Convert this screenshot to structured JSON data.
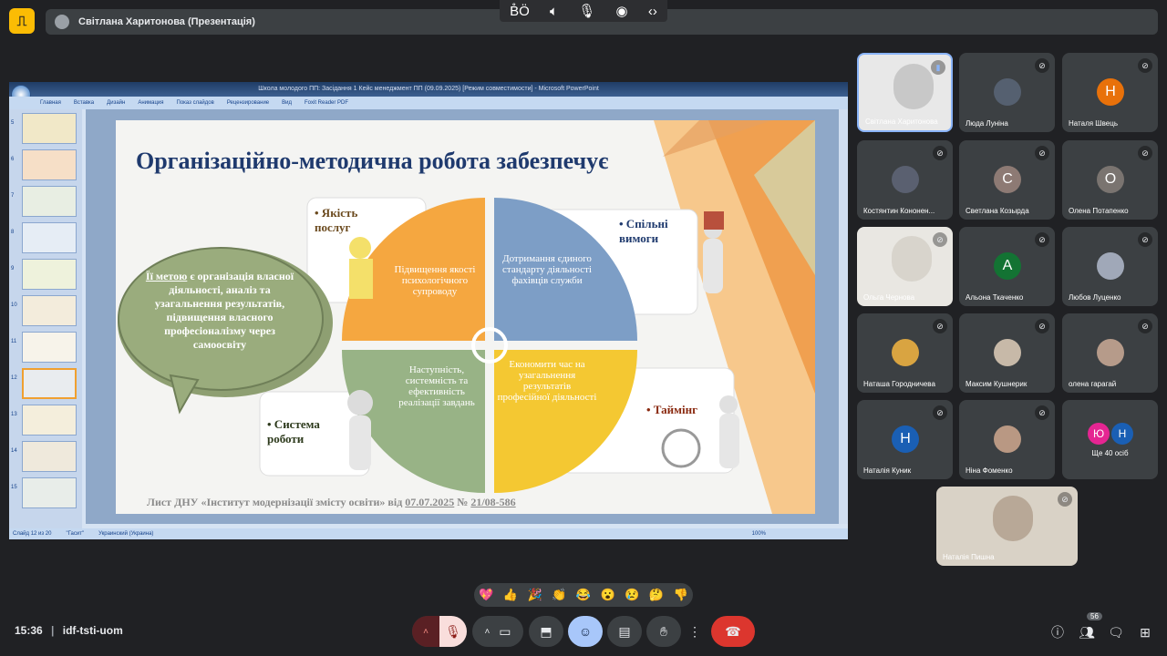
{
  "presenter_bar": {
    "title": "Світлана Харитонова (Презентація)"
  },
  "ppt": {
    "window_title": "Школа молодого ПП: Засідання 1 Кейс менеджмент ПП (09.09.2025) [Режим совместимости] - Microsoft PowerPoint",
    "ribbon_tabs": [
      "Главная",
      "Вставка",
      "Дизайн",
      "Анимация",
      "Показ слайдов",
      "Рецензирование",
      "Вид",
      "Foxit Reader PDF"
    ],
    "thumb_numbers": [
      "5",
      "6",
      "7",
      "8",
      "9",
      "10",
      "11",
      "12",
      "13",
      "14",
      "15"
    ],
    "status": {
      "slide": "Слайд 12 из 20",
      "theme": "\"Гасит\"",
      "lang": "Украинский (Украина)",
      "zoom": "100%"
    }
  },
  "slide": {
    "title": "Організаційно-методична робота забезпечує",
    "bubble": {
      "lead": "Її метою",
      "rest": " є організація власної діяльності, аналіз та узагальнення результатів, підвищення власного професіоналізму через самоосвіту"
    },
    "corner_labels": {
      "top_left": "• Якість послуг",
      "top_right": "• Спільні вимоги",
      "bottom_left": "• Система роботи",
      "bottom_right": "• Таймінг"
    },
    "quadrants": {
      "q1": "Підвищення якості психологічного супроводу",
      "q2": "Дотримання єдиного стандарту діяльності фахівців служби",
      "q3": "Наступність, системність та ефективність реалізації завдань",
      "q4": "Економити час на узагальнення результатів професійної діяльності"
    },
    "footer": {
      "prefix": "Лист ДНУ «Інститут модернізації змісту освіти» від ",
      "date": "07.07.2025",
      "mid": " № ",
      "num": "21/08-586"
    }
  },
  "participants": [
    {
      "name": "Світлана Харитонова",
      "initial": "",
      "color": "#c8c8c8"
    },
    {
      "name": "Люда Луніна",
      "initial": "",
      "color": "#556070"
    },
    {
      "name": "Наталя Швець",
      "initial": "Н",
      "color": "#e8710a"
    },
    {
      "name": "Костянтин Кононен...",
      "initial": "",
      "color": "#5a6070"
    },
    {
      "name": "Светлана Козырда",
      "initial": "С",
      "color": "#8d7a74"
    },
    {
      "name": "Олена Потапенко",
      "initial": "О",
      "color": "#7a7470"
    },
    {
      "name": "Ольга Чернова",
      "initial": "",
      "color": "#d8d4cc"
    },
    {
      "name": "Альона Ткаченко",
      "initial": "А",
      "color": "#137333"
    },
    {
      "name": "Любов Луценко",
      "initial": "",
      "color": "#a0a8b8"
    },
    {
      "name": "Наташа Городничева",
      "initial": "",
      "color": "#d9a441"
    },
    {
      "name": "Максим Кушнерик",
      "initial": "",
      "color": "#c7b9a8"
    },
    {
      "name": "олена гарагай",
      "initial": "",
      "color": "#b69b8a"
    },
    {
      "name": "Наталія Куник",
      "initial": "Н",
      "color": "#1a5fb4"
    },
    {
      "name": "Ніна Фоменко",
      "initial": "",
      "color": "#b99883"
    },
    {
      "name": "Ще 40 осіб",
      "initial": "",
      "color": ""
    },
    {
      "name": "Наталія Пишна",
      "initial": "",
      "color": "#b8a897"
    }
  ],
  "more_avatars": [
    "Ю",
    "Н"
  ],
  "reactions": [
    "💖",
    "👍",
    "🎉",
    "👏",
    "😂",
    "😮",
    "😢",
    "🤔",
    "👎"
  ],
  "bottom": {
    "time": "15:36",
    "meeting_code": "idf-tsti-uom",
    "people_count": "56"
  }
}
